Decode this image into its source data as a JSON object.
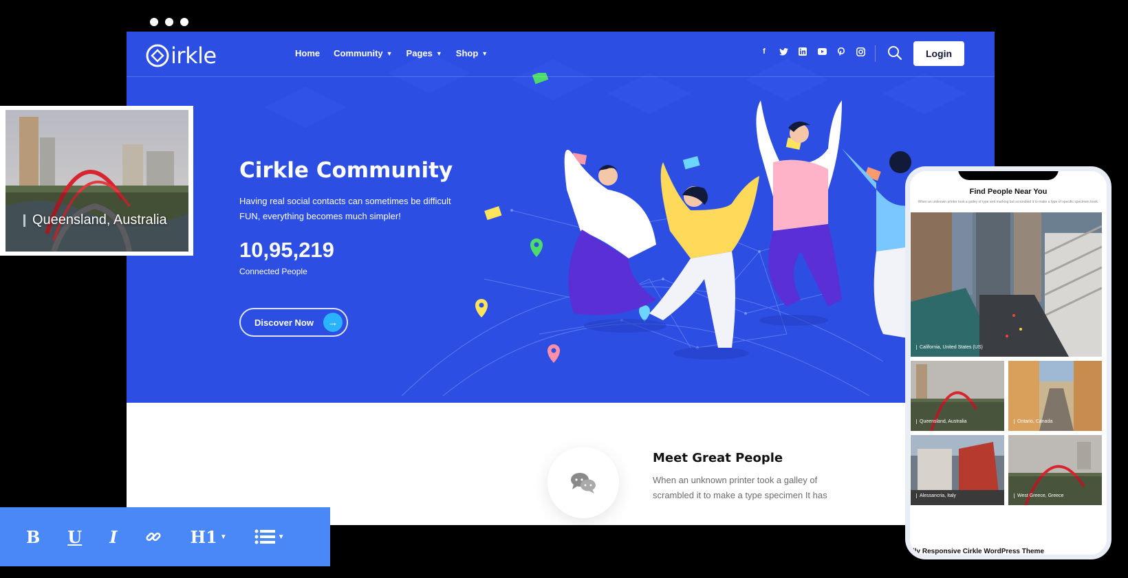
{
  "nav": {
    "logo_text": "irkle",
    "menu": [
      {
        "label": "Home",
        "dropdown": false
      },
      {
        "label": "Community",
        "dropdown": true
      },
      {
        "label": "Pages",
        "dropdown": true
      },
      {
        "label": "Shop",
        "dropdown": true
      }
    ],
    "social_icons": [
      "facebook-icon",
      "twitter-icon",
      "linkedin-icon",
      "youtube-icon",
      "pinterest-icon",
      "instagram-icon"
    ],
    "login_label": "Login"
  },
  "hero": {
    "title": "Cirkle Community",
    "description": "Having real social contacts can sometimes be difficult FUN, everything becomes much simpler!",
    "stat_number": "10,95,219",
    "stat_label": "Connected People",
    "cta_label": "Discover Now"
  },
  "feature": {
    "title": "Meet Great People",
    "description": "When an unknown printer took a galley of scrambled it to make a type specimen It has"
  },
  "image_card": {
    "caption": "Queensland, Australia"
  },
  "toolbar": {
    "bold": "B",
    "underline": "U",
    "italic": "I",
    "heading": "H1"
  },
  "phone": {
    "title": "Find People Near You",
    "subtitle": "When an unknown printer took a galley of type and marking but scrambled it to make a type of specific specimen book.",
    "featured_caption": "California, United States (US)",
    "grid": [
      {
        "caption": "Queensland, Australia"
      },
      {
        "caption": "Ontario, Canada"
      },
      {
        "caption": "Alessancria, Italy"
      },
      {
        "caption": "West Greece, Greece"
      }
    ],
    "footer": "lly Responsive Cirkle WordPress Theme"
  },
  "colors": {
    "hero_blue": "#2d4ee3",
    "toolbar_blue": "#4a87f7",
    "accent_cyan": "#2ab4ff"
  }
}
